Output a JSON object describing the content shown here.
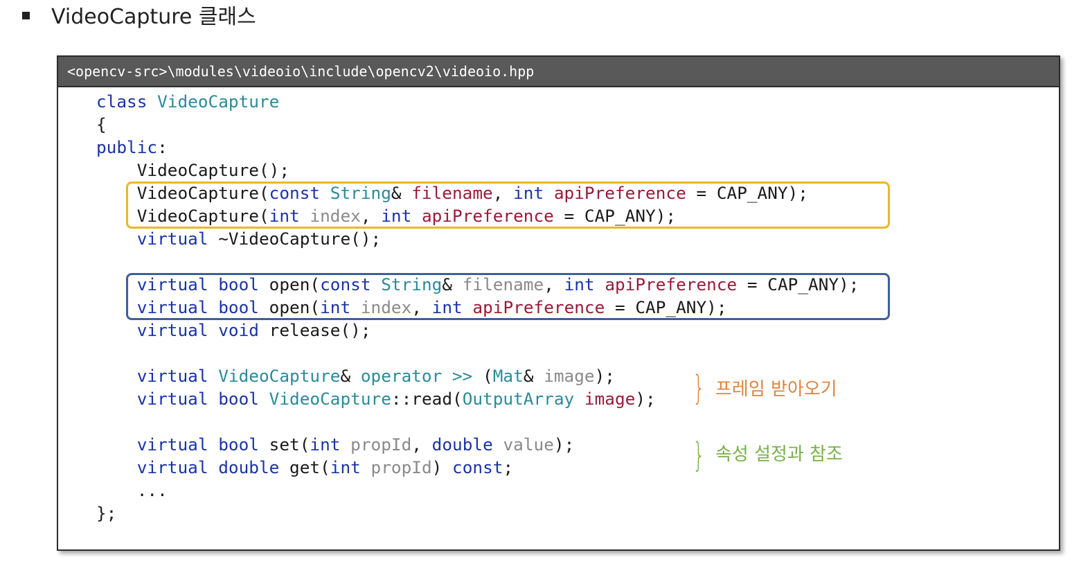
{
  "heading": {
    "text": "VideoCapture 클래스"
  },
  "panel": {
    "header": "<opencv-src>\\modules\\videoio\\include\\opencv2\\videoio.hpp"
  },
  "code": [
    [
      [
        "class",
        "kw"
      ],
      [
        " ",
        ""
      ],
      [
        "VideoCapture",
        "ty"
      ]
    ],
    [
      [
        "{",
        ""
      ]
    ],
    [
      [
        "public",
        "kw"
      ],
      [
        ":",
        ""
      ]
    ],
    [
      [
        "    VideoCapture();",
        ""
      ]
    ],
    [
      [
        "    VideoCapture(",
        ""
      ],
      [
        "const",
        "kw"
      ],
      [
        " ",
        ""
      ],
      [
        "String",
        "ty"
      ],
      [
        "& ",
        ""
      ],
      [
        "filename",
        "vr"
      ],
      [
        ", ",
        ""
      ],
      [
        "int",
        "kw"
      ],
      [
        " ",
        ""
      ],
      [
        "apiPreference",
        "vr"
      ],
      [
        " = CAP_ANY);",
        ""
      ]
    ],
    [
      [
        "    VideoCapture(",
        ""
      ],
      [
        "int",
        "kw"
      ],
      [
        " ",
        ""
      ],
      [
        "index",
        "pa"
      ],
      [
        ", ",
        ""
      ],
      [
        "int",
        "kw"
      ],
      [
        " ",
        ""
      ],
      [
        "apiPreference",
        "vr"
      ],
      [
        " = CAP_ANY);",
        ""
      ]
    ],
    [
      [
        "    ",
        ""
      ],
      [
        "virtual",
        "kw"
      ],
      [
        " ~VideoCapture();",
        ""
      ]
    ],
    [],
    [
      [
        "    ",
        ""
      ],
      [
        "virtual",
        "kw"
      ],
      [
        " ",
        ""
      ],
      [
        "bool",
        "kw"
      ],
      [
        " open(",
        ""
      ],
      [
        "const",
        "kw"
      ],
      [
        " ",
        ""
      ],
      [
        "String",
        "ty"
      ],
      [
        "& ",
        ""
      ],
      [
        "filename",
        "pa"
      ],
      [
        ", ",
        ""
      ],
      [
        "int",
        "kw"
      ],
      [
        " ",
        ""
      ],
      [
        "apiPreference",
        "vr"
      ],
      [
        " = CAP_ANY);",
        ""
      ]
    ],
    [
      [
        "    ",
        ""
      ],
      [
        "virtual",
        "kw"
      ],
      [
        " ",
        ""
      ],
      [
        "bool",
        "kw"
      ],
      [
        " open(",
        ""
      ],
      [
        "int",
        "kw"
      ],
      [
        " ",
        ""
      ],
      [
        "index",
        "pa"
      ],
      [
        ", ",
        ""
      ],
      [
        "int",
        "kw"
      ],
      [
        " ",
        ""
      ],
      [
        "apiPreference",
        "vr"
      ],
      [
        " = CAP_ANY);",
        ""
      ]
    ],
    [
      [
        "    ",
        ""
      ],
      [
        "virtual",
        "kw"
      ],
      [
        " ",
        ""
      ],
      [
        "void",
        "kw"
      ],
      [
        " release();",
        ""
      ]
    ],
    [],
    [
      [
        "    ",
        ""
      ],
      [
        "virtual",
        "kw"
      ],
      [
        " ",
        ""
      ],
      [
        "VideoCapture",
        "ty"
      ],
      [
        "& ",
        ""
      ],
      [
        "operator",
        "ty"
      ],
      [
        " ",
        ""
      ],
      [
        ">>",
        "ty"
      ],
      [
        " (",
        ""
      ],
      [
        "Mat",
        "ty"
      ],
      [
        "& ",
        ""
      ],
      [
        "image",
        "pa"
      ],
      [
        ");",
        ""
      ]
    ],
    [
      [
        "    ",
        ""
      ],
      [
        "virtual",
        "kw"
      ],
      [
        " ",
        ""
      ],
      [
        "bool",
        "kw"
      ],
      [
        " ",
        ""
      ],
      [
        "VideoCapture",
        "ty"
      ],
      [
        "::read(",
        ""
      ],
      [
        "OutputArray",
        "ty"
      ],
      [
        " ",
        ""
      ],
      [
        "image",
        "vr"
      ],
      [
        ");",
        ""
      ]
    ],
    [],
    [
      [
        "    ",
        ""
      ],
      [
        "virtual",
        "kw"
      ],
      [
        " ",
        ""
      ],
      [
        "bool",
        "kw"
      ],
      [
        " set(",
        ""
      ],
      [
        "int",
        "kw"
      ],
      [
        " ",
        ""
      ],
      [
        "propId",
        "pa"
      ],
      [
        ", ",
        ""
      ],
      [
        "double",
        "kw"
      ],
      [
        " ",
        ""
      ],
      [
        "value",
        "pa"
      ],
      [
        ");",
        ""
      ]
    ],
    [
      [
        "    ",
        ""
      ],
      [
        "virtual",
        "kw"
      ],
      [
        " ",
        ""
      ],
      [
        "double",
        "kw"
      ],
      [
        " get(",
        ""
      ],
      [
        "int",
        "kw"
      ],
      [
        " ",
        ""
      ],
      [
        "propId",
        "pa"
      ],
      [
        ") ",
        ""
      ],
      [
        "const",
        "kw"
      ],
      [
        ";",
        ""
      ]
    ],
    [
      [
        "    ...",
        ""
      ]
    ],
    [
      [
        "};",
        ""
      ]
    ]
  ],
  "annotations": {
    "frame_read": "프레임 받아오기",
    "property": "속성 설정과 참조"
  },
  "colors": {
    "keyword": "#1a33a8",
    "type": "#2b8a9a",
    "variable": "#9a1a3a",
    "param": "#8a8a8a",
    "highlight_constructors": "#e8b828",
    "highlight_open": "#3f5f9a",
    "note_frame": "#e0843c",
    "note_property": "#7ab04a"
  }
}
